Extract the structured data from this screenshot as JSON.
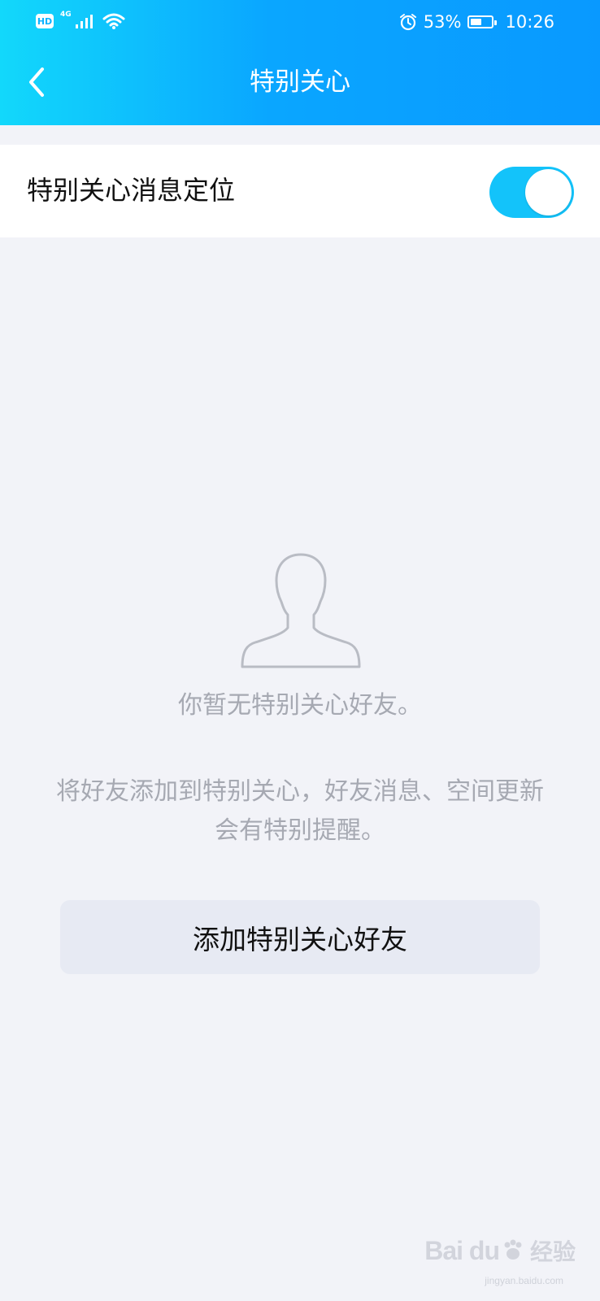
{
  "status_bar": {
    "hd": "HD",
    "network": "4G",
    "battery_percent_text": "53%",
    "battery_level": 0.53,
    "time": "10:26",
    "icons": [
      "hd-icon",
      "signal-icon",
      "wifi-icon",
      "alarm-icon",
      "battery-icon"
    ]
  },
  "header": {
    "title": "特别关心",
    "back_icon": "chevron-left-icon",
    "gradient": [
      "#12d8fb",
      "#0999ff"
    ]
  },
  "settings": {
    "locate_label": "特别关心消息定位",
    "locate_enabled": true,
    "toggle_color": "#13c3fa"
  },
  "empty_state": {
    "icon": "person-outline-icon",
    "title": "你暂无特别关心好友。",
    "description_line1": "将好友添加到特别关心，好友消息、空间更新",
    "description_line2": "会有特别提醒。"
  },
  "actions": {
    "add_button": "添加特别关心好友"
  },
  "watermark": {
    "logo": "Bai du",
    "text": "经验",
    "url": "jingyan.baidu.com"
  }
}
